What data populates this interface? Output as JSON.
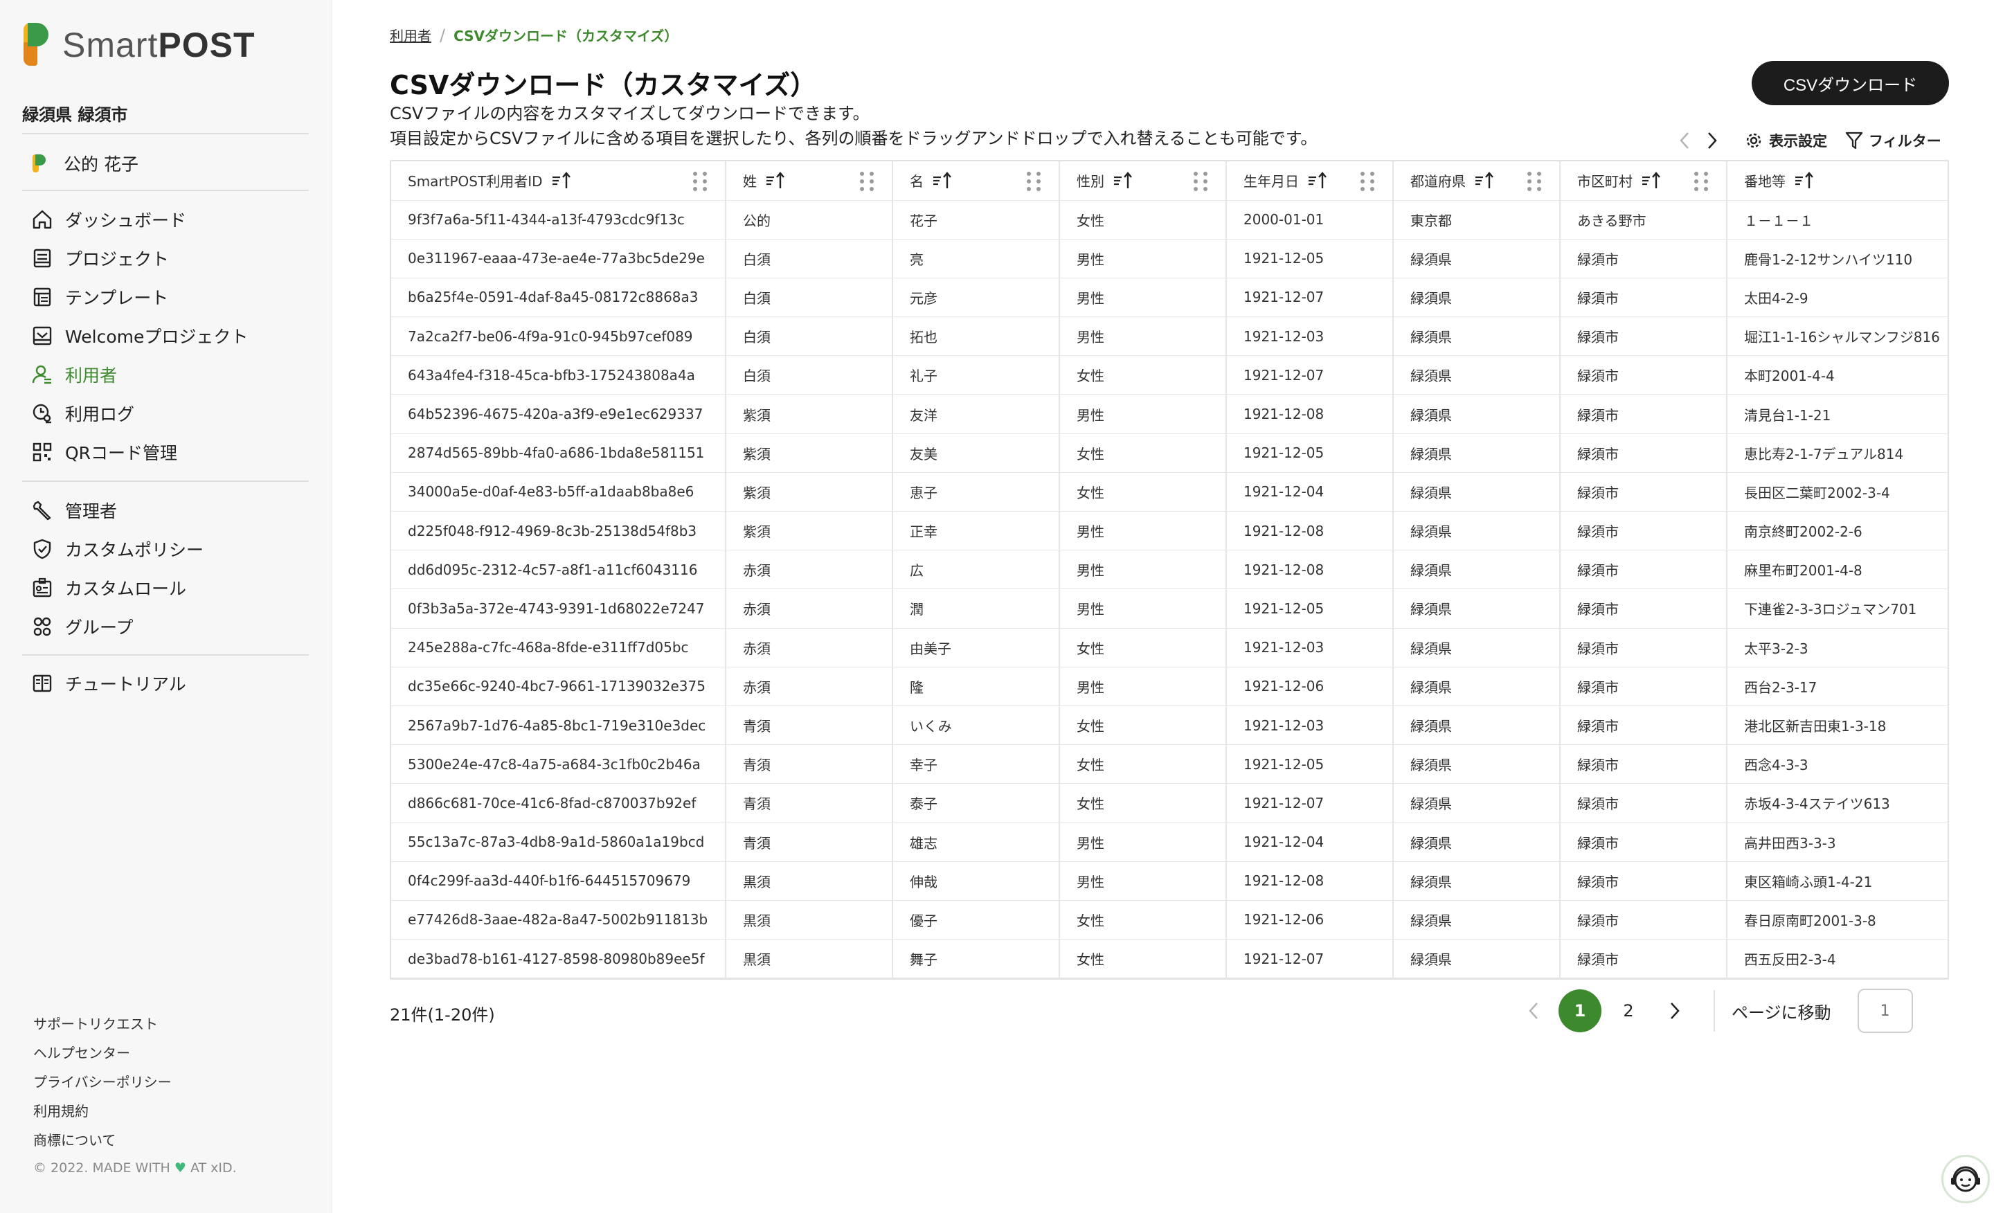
{
  "brand": {
    "name_light": "Smart",
    "name_bold": "POST"
  },
  "sidebar": {
    "org": "緑須県 緑須市",
    "user": "公的 花子",
    "nav_main": [
      {
        "label": "ダッシュボード",
        "icon": "home-icon"
      },
      {
        "label": "プロジェクト",
        "icon": "project-icon"
      },
      {
        "label": "テンプレート",
        "icon": "template-icon"
      },
      {
        "label": "Welcomeプロジェクト",
        "icon": "welcome-icon"
      },
      {
        "label": "利用者",
        "icon": "user-icon",
        "active": true
      },
      {
        "label": "利用ログ",
        "icon": "log-icon"
      },
      {
        "label": "QRコード管理",
        "icon": "qr-icon"
      }
    ],
    "nav_admin": [
      {
        "label": "管理者",
        "icon": "wrench-icon"
      },
      {
        "label": "カスタムポリシー",
        "icon": "shield-icon"
      },
      {
        "label": "カスタムロール",
        "icon": "id-card-icon"
      },
      {
        "label": "グループ",
        "icon": "group-icon"
      }
    ],
    "nav_help": [
      {
        "label": "チュートリアル",
        "icon": "book-icon"
      }
    ],
    "footer_links": [
      "サポートリクエスト",
      "ヘルプセンター",
      "プライバシーポリシー",
      "利用規約",
      "商標について"
    ],
    "copyright_prefix": "© 2022. MADE WITH",
    "copyright_suffix": "AT xID."
  },
  "breadcrumb": {
    "parent": "利用者",
    "current": "CSVダウンロード（カスタマイズ）"
  },
  "page": {
    "title": "CSVダウンロード（カスタマイズ）",
    "desc_line1": "CSVファイルの内容をカスタマイズしてダウンロードできます。",
    "desc_line2": "項目設定からCSVファイルに含める項目を選択したり、各列の順番をドラッグアンドドロップで入れ替えることも可能です。",
    "download_button": "CSVダウンロード"
  },
  "toolbar": {
    "display_settings": "表示設定",
    "filter": "フィルター"
  },
  "table": {
    "columns": [
      "SmartPOST利用者ID",
      "姓",
      "名",
      "性別",
      "生年月日",
      "都道府県",
      "市区町村",
      "番地等"
    ],
    "rows": [
      [
        "9f3f7a6a-5f11-4344-a13f-4793cdc9f13c",
        "公的",
        "花子",
        "女性",
        "2000-01-01",
        "東京都",
        "あきる野市",
        "１－１－１"
      ],
      [
        "0e311967-eaaa-473e-ae4e-77a3bc5de29e",
        "白須",
        "亮",
        "男性",
        "1921-12-05",
        "緑須県",
        "緑須市",
        "鹿骨1-2-12サンハイツ110"
      ],
      [
        "b6a25f4e-0591-4daf-8a45-08172c8868a3",
        "白須",
        "元彦",
        "男性",
        "1921-12-07",
        "緑須県",
        "緑須市",
        "太田4-2-9"
      ],
      [
        "7a2ca2f7-be06-4f9a-91c0-945b97cef089",
        "白須",
        "拓也",
        "男性",
        "1921-12-03",
        "緑須県",
        "緑須市",
        "堀江1-1-16シャルマンフジ816"
      ],
      [
        "643a4fe4-f318-45ca-bfb3-175243808a4a",
        "白須",
        "礼子",
        "女性",
        "1921-12-07",
        "緑須県",
        "緑須市",
        "本町2001-4-4"
      ],
      [
        "64b52396-4675-420a-a3f9-e9e1ec629337",
        "紫須",
        "友洋",
        "男性",
        "1921-12-08",
        "緑須県",
        "緑須市",
        "清見台1-1-21"
      ],
      [
        "2874d565-89bb-4fa0-a686-1bda8e581151",
        "紫須",
        "友美",
        "女性",
        "1921-12-05",
        "緑須県",
        "緑須市",
        "恵比寿2-1-7デュアル814"
      ],
      [
        "34000a5e-d0af-4e83-b5ff-a1daab8ba8e6",
        "紫須",
        "恵子",
        "女性",
        "1921-12-04",
        "緑須県",
        "緑須市",
        "長田区二葉町2002-3-4"
      ],
      [
        "d225f048-f912-4969-8c3b-25138d54f8b3",
        "紫須",
        "正幸",
        "男性",
        "1921-12-08",
        "緑須県",
        "緑須市",
        "南京終町2002-2-6"
      ],
      [
        "dd6d095c-2312-4c57-a8f1-a11cf6043116",
        "赤須",
        "広",
        "男性",
        "1921-12-08",
        "緑須県",
        "緑須市",
        "麻里布町2001-4-8"
      ],
      [
        "0f3b3a5a-372e-4743-9391-1d68022e7247",
        "赤須",
        "潤",
        "男性",
        "1921-12-05",
        "緑須県",
        "緑須市",
        "下連雀2-3-3ロジュマン701"
      ],
      [
        "245e288a-c7fc-468a-8fde-e311ff7d05bc",
        "赤須",
        "由美子",
        "女性",
        "1921-12-03",
        "緑須県",
        "緑須市",
        "太平3-2-3"
      ],
      [
        "dc35e66c-9240-4bc7-9661-17139032e375",
        "赤須",
        "隆",
        "男性",
        "1921-12-06",
        "緑須県",
        "緑須市",
        "西台2-3-17"
      ],
      [
        "2567a9b7-1d76-4a85-8bc1-719e310e3dec",
        "青須",
        "いくみ",
        "女性",
        "1921-12-03",
        "緑須県",
        "緑須市",
        "港北区新吉田東1-3-18"
      ],
      [
        "5300e24e-47c8-4a75-a684-3c1fb0c2b46a",
        "青須",
        "幸子",
        "女性",
        "1921-12-05",
        "緑須県",
        "緑須市",
        "西念4-3-3"
      ],
      [
        "d866c681-70ce-41c6-8fad-c870037b92ef",
        "青須",
        "泰子",
        "女性",
        "1921-12-07",
        "緑須県",
        "緑須市",
        "赤坂4-3-4ステイツ613"
      ],
      [
        "55c13a7c-87a3-4db8-9a1d-5860a1a19bcd",
        "青須",
        "雄志",
        "男性",
        "1921-12-04",
        "緑須県",
        "緑須市",
        "高井田西3-3-3"
      ],
      [
        "0f4c299f-aa3d-440f-b1f6-644515709679",
        "黒須",
        "伸哉",
        "男性",
        "1921-12-08",
        "緑須県",
        "緑須市",
        "東区箱崎ふ頭1-4-21"
      ],
      [
        "e77426d8-3aae-482a-8a47-5002b911813b",
        "黒須",
        "優子",
        "女性",
        "1921-12-06",
        "緑須県",
        "緑須市",
        "春日原南町2001-3-8"
      ],
      [
        "de3bad78-b161-4127-8598-80980b89ee5f",
        "黒須",
        "舞子",
        "女性",
        "1921-12-07",
        "緑須県",
        "緑須市",
        "西五反田2-3-4"
      ]
    ]
  },
  "pagination": {
    "count_text": "21件(1-20件)",
    "pages": [
      "1",
      "2"
    ],
    "current": "1",
    "goto_label": "ページに移動",
    "goto_placeholder": "1"
  },
  "colors": {
    "accent": "#3d8a2e",
    "dark_button": "#1c1c1c"
  }
}
